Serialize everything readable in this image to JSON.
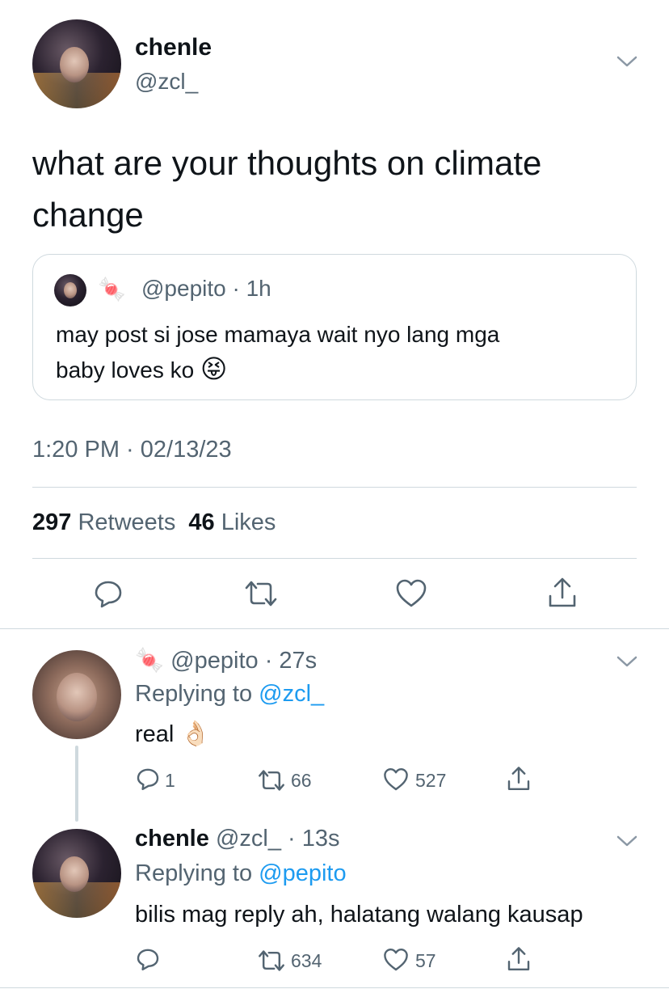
{
  "tweet": {
    "author_name": "chenle",
    "author_handle": "@zcl_",
    "text_line1": "what are your thoughts on climate",
    "text_line2": "change",
    "quoted": {
      "handle": "@pepito",
      "age": "· 1h",
      "line1": "may post si jose mamaya wait nyo lang mga",
      "line2": "baby loves ko",
      "emoji": "😝"
    },
    "timestamp": "1:20 PM · 02/13/23",
    "retweets_count": "297",
    "retweets_label": "Retweets",
    "likes_count": "46",
    "likes_label": "Likes"
  },
  "replies": [
    {
      "handle": "@pepito",
      "age": "· 27s",
      "replying_prefix": "Replying to",
      "replying_to": "@zcl_",
      "text": "real",
      "emoji": "👌🏻",
      "reply_count": "1",
      "retweet_count": "66",
      "like_count": "527"
    },
    {
      "name": "chenle",
      "handle": "@zcl_",
      "age": "· 13s",
      "replying_prefix": "Replying to",
      "replying_to": "@pepito",
      "text": "bilis mag reply ah, halatang walang kausap",
      "reply_count": "",
      "retweet_count": "634",
      "like_count": "57"
    }
  ],
  "name_emoji": "🍬",
  "colors": {
    "link": "#1d9bf0",
    "secondary": "#536471",
    "divider": "#cfd9de"
  },
  "icons": [
    "chevron-down-icon",
    "reply-icon",
    "retweet-icon",
    "like-icon",
    "share-icon"
  ]
}
